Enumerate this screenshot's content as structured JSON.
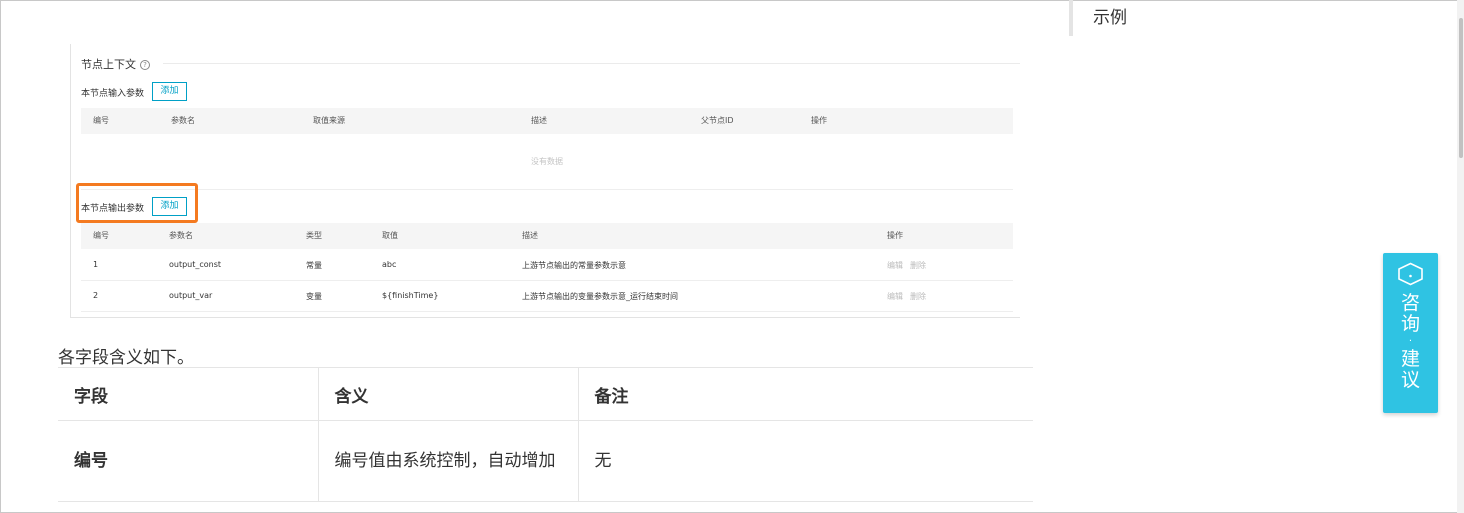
{
  "toc": {
    "item": "示例"
  },
  "embedded": {
    "context_title": "节点上下文",
    "help_glyph": "?",
    "input_section": {
      "label": "本节点输入参数",
      "add_label": "添加",
      "headers": [
        "编号",
        "参数名",
        "取值来源",
        "描述",
        "父节点ID",
        "操作"
      ],
      "empty_text": "没有数据"
    },
    "output_section": {
      "label": "本节点输出参数",
      "add_label": "添加",
      "headers": [
        "编号",
        "参数名",
        "类型",
        "取值",
        "描述",
        "操作"
      ],
      "rows": [
        {
          "id": "1",
          "name": "output_const",
          "type": "常量",
          "value": "abc",
          "desc": "上游节点输出的常量参数示意",
          "edit": "编辑",
          "delete": "删除"
        },
        {
          "id": "2",
          "name": "output_var",
          "type": "变量",
          "value": "${finishTime}",
          "desc": "上游节点输出的变量参数示意_运行结束时间",
          "edit": "编辑",
          "delete": "删除"
        }
      ]
    },
    "highlight_color": "#f47a20"
  },
  "paragraph": "各字段含义如下。",
  "doc_table": {
    "headers": [
      "字段",
      "含义",
      "备注"
    ],
    "rows": [
      {
        "field": "编号",
        "meaning": "编号值由系统控制，自动增加",
        "note": "无"
      }
    ]
  },
  "consult_button": {
    "line1": "咨询",
    "separator": "·",
    "line2": "建议",
    "color": "#2fc3e3"
  }
}
